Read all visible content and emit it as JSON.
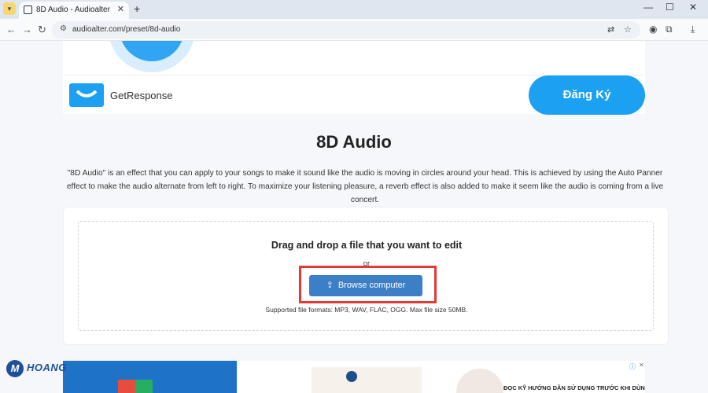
{
  "browser": {
    "tab_title": "8D Audio - Audioalter",
    "url": "audioalter.com/preset/8d-audio"
  },
  "ad_top": {
    "brand": "GetResponse",
    "cta": "Đăng Ký"
  },
  "page": {
    "title": "8D Audio",
    "description": "\"8D Audio\" is an effect that you can apply to your songs to make it sound like the audio is moving in circles around your head. This is achieved by using the Auto Panner effect to make the audio alternate from left to right. To maximize your listening pleasure, a reverb effect is also added to make it seem like the audio is coming from a live concert."
  },
  "upload": {
    "heading": "Drag and drop a file that you want to edit",
    "or": "or",
    "browse_label": "Browse computer",
    "formats": "Supported file formats: MP3, WAV, FLAC, OGG. Max file size 50MB."
  },
  "ad_bottom": {
    "headline": "ĐỌC KỸ HƯỚNG DẪN SỬ DỤNG TRƯỚC KHI DÙNG"
  },
  "watermark": {
    "brand": "HOANG"
  },
  "icons": [
    "tab-menu-icon",
    "favicon-icon",
    "close-icon",
    "plus-icon",
    "back-icon",
    "forward-icon",
    "reload-icon",
    "site-info-icon",
    "translate-icon",
    "star-icon",
    "profile-icon",
    "extensions-icon",
    "download-icon",
    "upload-icon",
    "ad-info-icon"
  ],
  "colors": {
    "accent": "#3d7fc6",
    "highlight": "#e53935",
    "ad_blue": "#1ba0f2"
  }
}
